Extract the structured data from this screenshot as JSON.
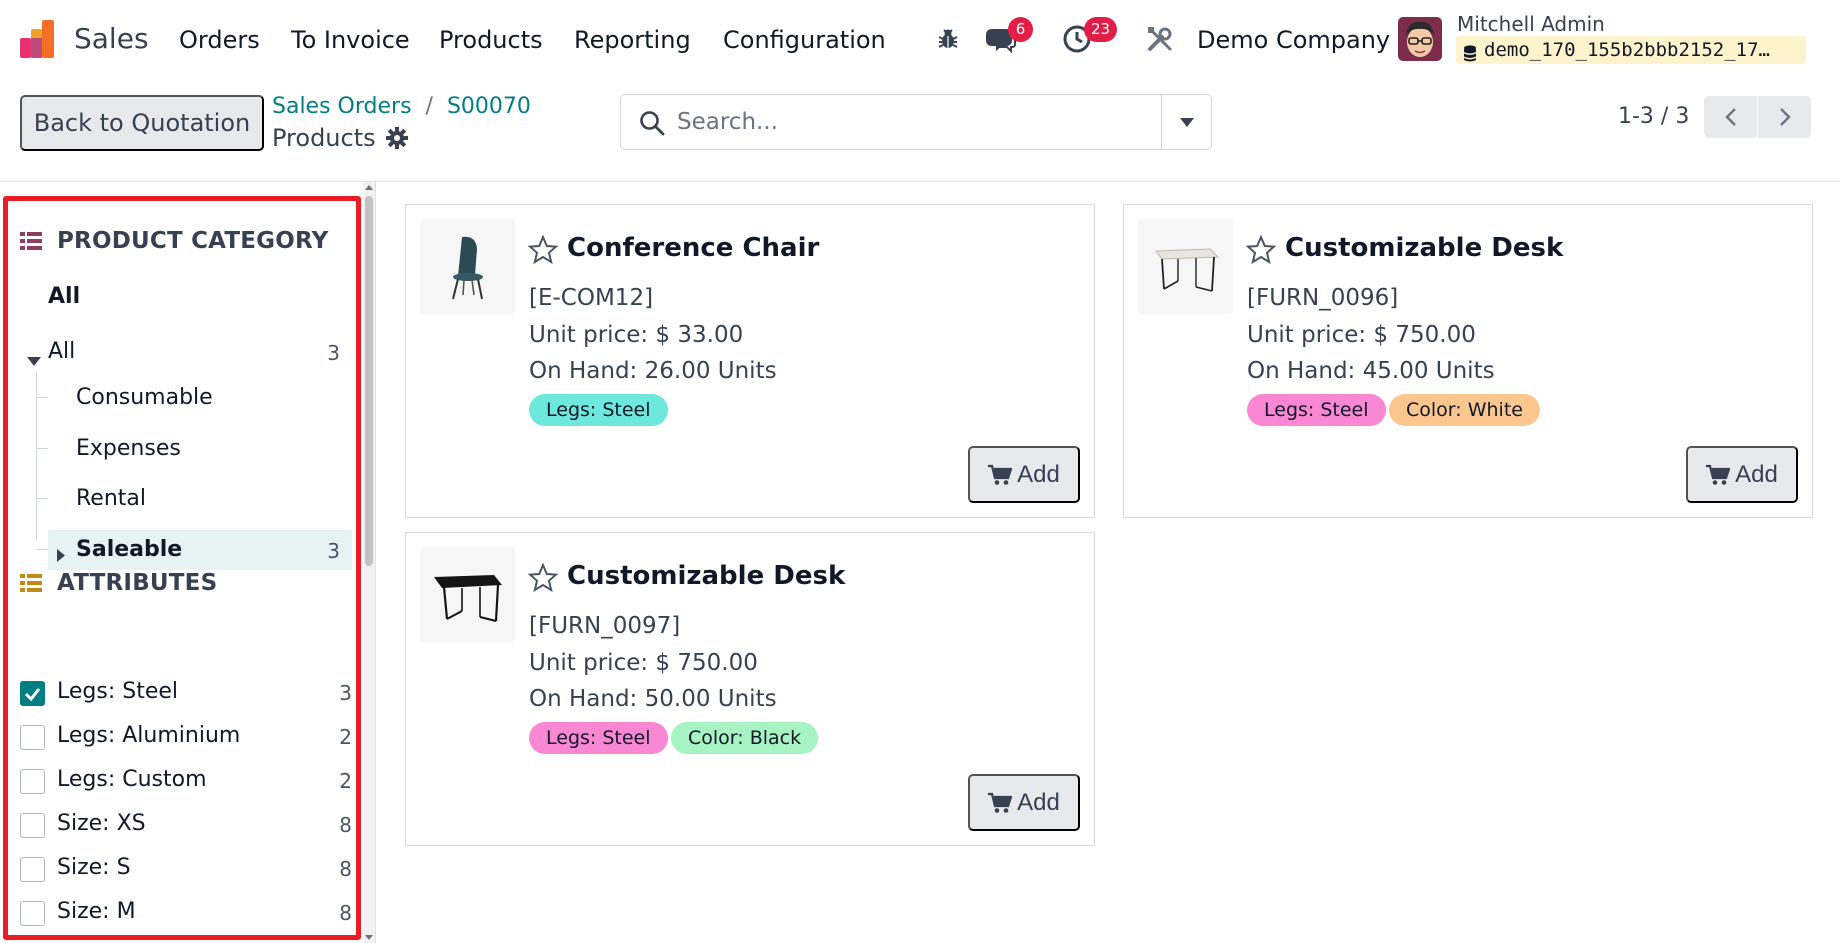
{
  "navbar": {
    "app_name": "Sales",
    "menus": [
      "Orders",
      "To Invoice",
      "Products",
      "Reporting",
      "Configuration"
    ],
    "messages_count": "6",
    "activities_count": "23",
    "company": "Demo Company",
    "user_name": "Mitchell Admin",
    "database": "demo_170_155b2bbb2152_17…"
  },
  "control_panel": {
    "back_label": "Back to Quotation",
    "breadcrumb": [
      "Sales Orders",
      "S00070"
    ],
    "current_page": "Products",
    "search_placeholder": "Search...",
    "pager": "1-3 / 3"
  },
  "sidebar": {
    "category_header": "PRODUCT CATEGORY",
    "category_all": "All",
    "tree_root": {
      "label": "All",
      "count": "3"
    },
    "categories": [
      {
        "label": "Consumable",
        "count": ""
      },
      {
        "label": "Expenses",
        "count": ""
      },
      {
        "label": "Rental",
        "count": ""
      },
      {
        "label": "Saleable",
        "count": "3",
        "active": true
      }
    ],
    "attributes_header": "ATTRIBUTES",
    "attributes": [
      {
        "label": "Legs: Steel",
        "count": "3",
        "checked": true
      },
      {
        "label": "Legs: Aluminium",
        "count": "2",
        "checked": false
      },
      {
        "label": "Legs: Custom",
        "count": "2",
        "checked": false
      },
      {
        "label": "Size: XS",
        "count": "8",
        "checked": false
      },
      {
        "label": "Size: S",
        "count": "8",
        "checked": false
      },
      {
        "label": "Size: M",
        "count": "8",
        "checked": false
      }
    ]
  },
  "products": [
    {
      "name": "Conference Chair",
      "code": "[E-COM12]",
      "price": "Unit price: $ 33.00",
      "on_hand": "On Hand: 26.00 Units",
      "tags": [
        {
          "label": "Legs: Steel",
          "color": "#6ee7dc"
        }
      ],
      "add_label": "Add"
    },
    {
      "name": "Customizable Desk",
      "code": "[FURN_0096]",
      "price": "Unit price: $ 750.00",
      "on_hand": "On Hand: 45.00 Units",
      "tags": [
        {
          "label": "Legs: Steel",
          "color": "#f987d4"
        },
        {
          "label": "Color: White",
          "color": "#fbc78f"
        }
      ],
      "add_label": "Add"
    },
    {
      "name": "Customizable Desk",
      "code": "[FURN_0097]",
      "price": "Unit price: $ 750.00",
      "on_hand": "On Hand: 50.00 Units",
      "tags": [
        {
          "label": "Legs: Steel",
          "color": "#f987d4"
        },
        {
          "label": "Color: Black",
          "color": "#a7f3c4"
        }
      ],
      "add_label": "Add"
    }
  ],
  "colors": {
    "accent": "#017e84",
    "badge": "#e11d48",
    "highlight_border": "#ec1c24"
  }
}
